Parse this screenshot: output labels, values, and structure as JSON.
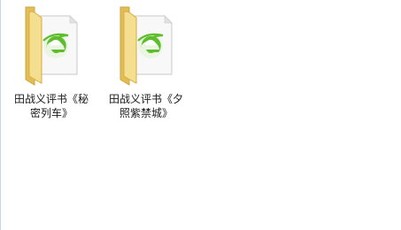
{
  "files": [
    {
      "name_line1": "田战义评书《秘",
      "name_line2": "密列车》",
      "icon": "folder-with-ie-document-icon"
    },
    {
      "name_line1": "田战义评书《夕",
      "name_line2": "照紫禁城》",
      "icon": "folder-with-ie-document-icon"
    }
  ],
  "colors": {
    "folder_back": "#e7c45c",
    "folder_front": "#f6e39a",
    "folder_edge": "#d8ad3e",
    "page": "#f7f7f7",
    "ie_green": "#5ebd2c"
  }
}
